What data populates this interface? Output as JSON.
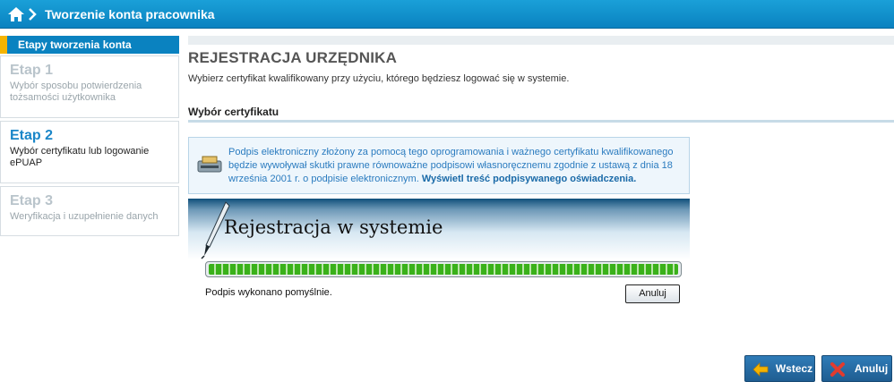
{
  "header": {
    "title": "Tworzenie konta pracownika"
  },
  "sidebar": {
    "heading": "Etapy tworzenia konta",
    "steps": [
      {
        "title": "Etap 1",
        "desc": "Wybór sposobu potwierdzenia tożsamości użytkownika",
        "state": "inactive"
      },
      {
        "title": "Etap 2",
        "desc": "Wybór certyfikatu lub logowanie ePUAP",
        "state": "active"
      },
      {
        "title": "Etap 3",
        "desc": "Weryfikacja i uzupełnienie danych",
        "state": "inactive"
      }
    ]
  },
  "main": {
    "title": "REJESTRACJA URZĘDNIKA",
    "subtitle": "Wybierz certyfikat kwalifikowany przy użyciu, którego będziesz logować się w systemie.",
    "section_title": "Wybór certyfikatu",
    "info": {
      "text": "Podpis elektroniczny złożony za pomocą tego oprogramowania i ważnego certyfikatu kwalifikowanego będzie wywoływał skutki prawne równoważne podpisowi własnoręcznemu zgodnie z ustawą z dnia 18 września 2001 r. o podpisie elektronicznym.",
      "link": "Wyświetl treść podpisywanego oświadczenia."
    },
    "banner_title": "Rejestracja w systemie",
    "progress_percent": 100,
    "status": "Podpis wykonano pomyślnie.",
    "cancel_small": "Anuluj"
  },
  "footer": {
    "back_label": "Wstecz",
    "cancel_label": "Anuluj"
  },
  "colors": {
    "accent": "#0a82c0",
    "highlight": "#f5b400",
    "progress": "#3ab11a"
  },
  "icons": [
    "home-icon",
    "chevron-right-icon",
    "printer-icon",
    "pen-icon",
    "arrow-left-icon",
    "close-x-icon"
  ]
}
